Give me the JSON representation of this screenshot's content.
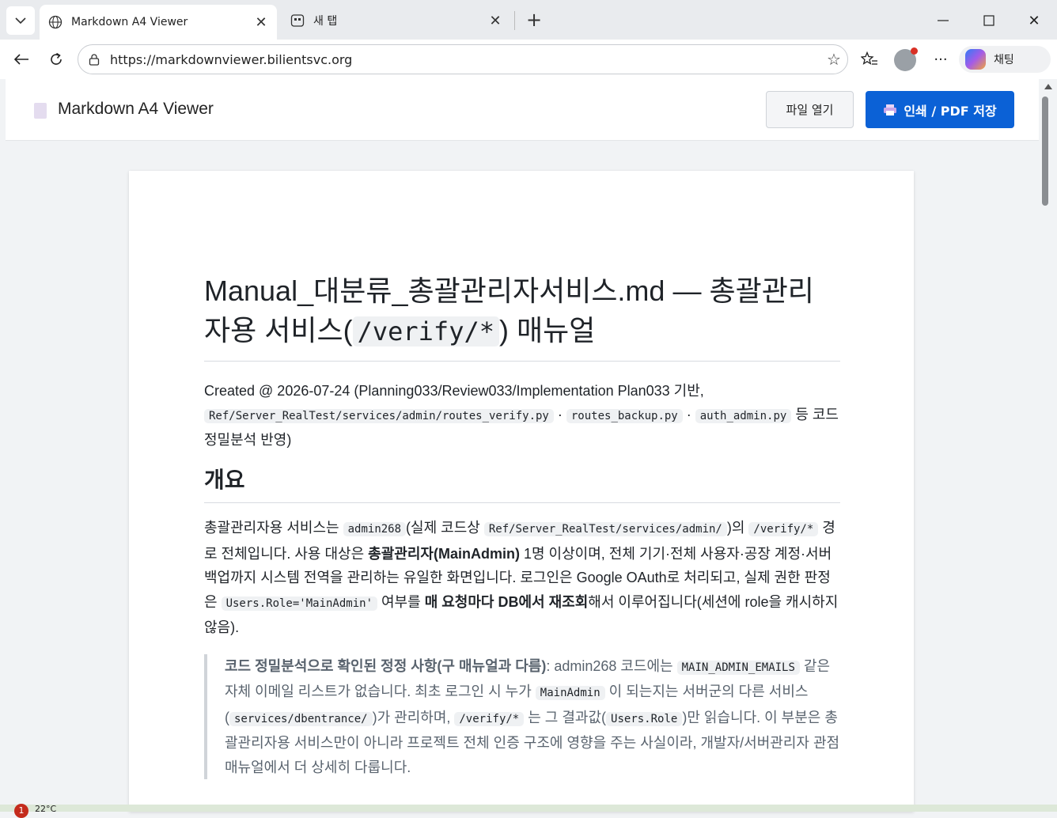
{
  "browser": {
    "tabs": [
      {
        "label": "Markdown A4 Viewer",
        "active": true
      },
      {
        "label": "새 탭",
        "active": false
      }
    ],
    "url": "https://markdownviewer.bilientsvc.org",
    "copilot_label": "채팅"
  },
  "app": {
    "title": "Markdown A4 Viewer",
    "open_button": "파일 열기",
    "print_button": "인쇄 / PDF 저장"
  },
  "doc": {
    "title_part1": "Manual_대분류_총괄관리자서비스.md — 총괄관리자용 서비스(",
    "title_code": "/verify/*",
    "title_part2": ") 매뉴얼",
    "meta_text1": "Created @ 2026-07-24 (Planning033/Review033/Implementation Plan033 기반, ",
    "meta_code1": "Ref/Server_RealTest/services/admin/routes_verify.py",
    "meta_sep1": " · ",
    "meta_code2": "routes_backup.py",
    "meta_sep2": " · ",
    "meta_code3": "auth_admin.py",
    "meta_text2": " 등 코드 정밀분석 반영)",
    "section_heading": "개요",
    "p1_t1": "총괄관리자용 서비스는 ",
    "p1_c1": "admin268",
    "p1_t2": "(실제 코드상 ",
    "p1_c2": "Ref/Server_RealTest/services/admin/",
    "p1_t3": ")의 ",
    "p1_c3": "/verify/*",
    "p1_t4": " 경로 전체입니다. 사용 대상은 ",
    "p1_b1": "총괄관리자(MainAdmin)",
    "p1_t5": " 1명 이상이며, 전체 기기·전체 사용자·공장 계정·서버 백업까지 시스템 전역을 관리하는 유일한 화면입니다. 로그인은 Google OAuth로 처리되고, 실제 권한 판정은 ",
    "p1_c4": "Users.Role='MainAdmin'",
    "p1_t6": " 여부를 ",
    "p1_b2": "매 요청마다 DB에서 재조회",
    "p1_t7": "해서 이루어집니다(세션에 role을 캐시하지 않음).",
    "q_b1": "코드 정밀분석으로 확인된 정정 사항(구 매뉴얼과 다름)",
    "q_t1": ": admin268 코드에는 ",
    "q_c1": "MAIN_ADMIN_EMAILS",
    "q_t2": " 같은 자체 이메일 리스트가 없습니다. 최초 로그인 시 누가 ",
    "q_c2": "MainAdmin",
    "q_t3": " 이 되는지는 서버군의 다른 서비스(",
    "q_c3": "services/dbentrance/",
    "q_t4": ")가 관리하며, ",
    "q_c4": "/verify/*",
    "q_t5": " 는 그 결과값(",
    "q_c5": "Users.Role",
    "q_t6": ")만 읽습니다. 이 부분은 총괄관리자용 서비스만이 아니라 프로젝트 전체 인증 구조에 영향을 주는 사실이라, 개발자/서버관리자 관점 매뉴얼에서 더 상세히 다룹니다."
  },
  "taskbar": {
    "badge": "1",
    "temp": "22°C"
  }
}
